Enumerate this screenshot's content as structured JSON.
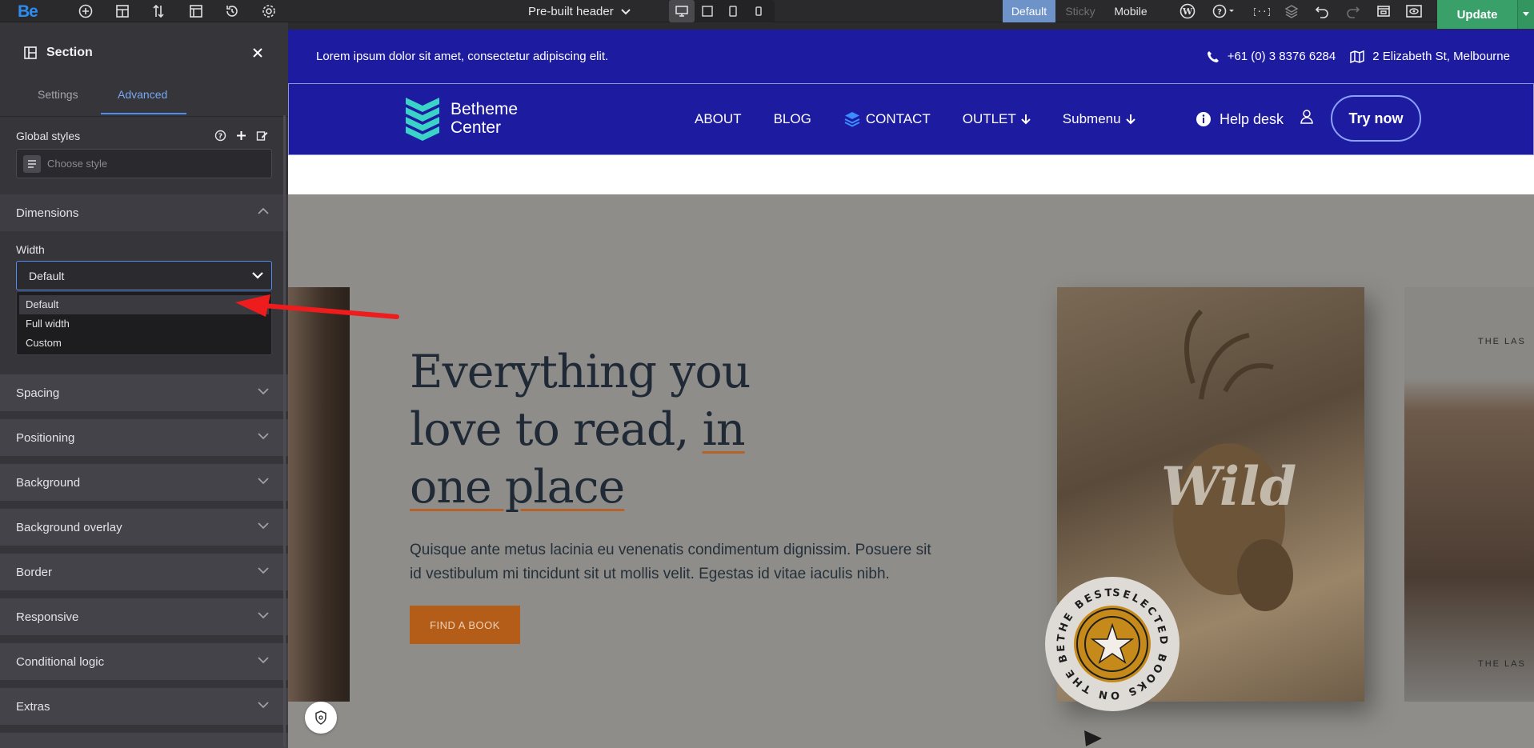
{
  "toolbar": {
    "logo": "Be",
    "template_selector": "Pre-built header",
    "states": {
      "default": "Default",
      "sticky": "Sticky",
      "mobile": "Mobile"
    },
    "update_label": "Update",
    "accent": "#2d8cf0",
    "update_color": "#3aa06a",
    "active_state_color": "#6d93c9"
  },
  "panel": {
    "title": "Section",
    "tabs": [
      "Settings",
      "Advanced"
    ],
    "active_tab": "Advanced",
    "global_styles_label": "Global styles",
    "choose_style_placeholder": "Choose style",
    "dimensions_label": "Dimensions",
    "width_label": "Width",
    "width_value": "Default",
    "width_options": [
      "Default",
      "Full width",
      "Custom"
    ],
    "sections": [
      "Spacing",
      "Positioning",
      "Background",
      "Background overlay",
      "Border",
      "Responsive",
      "Conditional logic",
      "Extras"
    ]
  },
  "preview": {
    "top_strip_text": "Lorem ipsum dolor sit amet, consectetur adipiscing elit.",
    "phone": "+61 (0) 3 8376 6284",
    "address": "2 Elizabeth St, Melbourne",
    "brand_line1": "Betheme",
    "brand_line2": "Center",
    "nav": [
      "ABOUT",
      "BLOG",
      "CONTACT",
      "OUTLET",
      "Submenu"
    ],
    "help_desk": "Help desk",
    "try_now": "Try now",
    "hero_title_line1": "Everything you",
    "hero_title_line2a": "love to read, ",
    "hero_title_line2b": "in",
    "hero_title_line3": "one place",
    "hero_text": "Quisque ante metus lacinia eu venenatis condimentum dignissim. Posuere sit id vestibulum mi tincidunt sit ut mollis velit. Egestas id vitae iaculis nibh.",
    "find_button": "FIND A BOOK",
    "book_title": "Wild",
    "badge_text": "SELECTED BOOKS ON THE BETHE BEST",
    "book2_top": "THE LAS",
    "book2_bottom": "THE LAS",
    "brand_color": "#1d1ba0"
  }
}
